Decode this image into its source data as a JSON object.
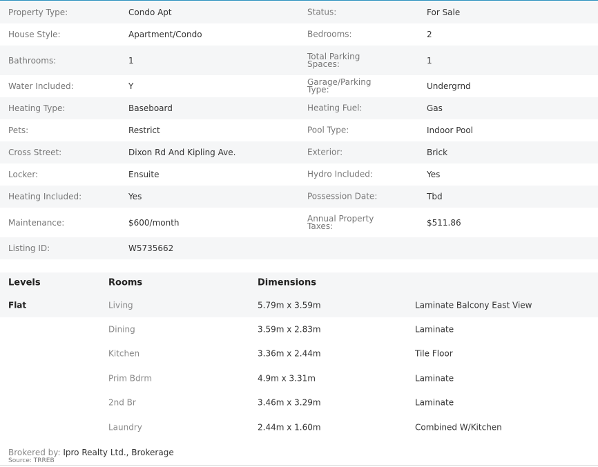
{
  "details": [
    {
      "l1": "Property Type:",
      "v1": "Condo Apt",
      "l2": "Status:",
      "v2": "For Sale"
    },
    {
      "l1": "House Style:",
      "v1": "Apartment/Condo",
      "l2": "Bedrooms:",
      "v2": "2"
    },
    {
      "l1": "Bathrooms:",
      "v1": "1",
      "l2": "Total Parking Spaces:",
      "v2": "1"
    },
    {
      "l1": "Water Included:",
      "v1": "Y",
      "l2": "Garage/Parking Type:",
      "v2": "Undergrnd"
    },
    {
      "l1": "Heating Type:",
      "v1": "Baseboard",
      "l2": "Heating Fuel:",
      "v2": "Gas"
    },
    {
      "l1": "Pets:",
      "v1": "Restrict",
      "l2": "Pool Type:",
      "v2": "Indoor Pool"
    },
    {
      "l1": "Cross Street:",
      "v1": "Dixon Rd And Kipling Ave.",
      "l2": "Exterior:",
      "v2": "Brick"
    },
    {
      "l1": "Locker:",
      "v1": "Ensuite",
      "l2": "Hydro Included:",
      "v2": "Yes"
    },
    {
      "l1": "Heating Included:",
      "v1": "Yes",
      "l2": "Possession Date:",
      "v2": "Tbd"
    },
    {
      "l1": "Maintenance:",
      "v1": "$600/month",
      "l2": "Annual Property Taxes:",
      "v2": "$511.86"
    },
    {
      "l1": "Listing ID:",
      "v1": "W5735662",
      "l2": "",
      "v2": ""
    }
  ],
  "rooms": {
    "headers": {
      "level": "Levels",
      "room": "Rooms",
      "dimensions": "Dimensions"
    },
    "rows": [
      {
        "level": "Flat",
        "room": "Living",
        "dimensions": "5.79m x 3.59m",
        "description": "Laminate Balcony East View"
      },
      {
        "level": "",
        "room": "Dining",
        "dimensions": "3.59m x 2.83m",
        "description": "Laminate"
      },
      {
        "level": "",
        "room": "Kitchen",
        "dimensions": "3.36m x 2.44m",
        "description": "Tile Floor"
      },
      {
        "level": "",
        "room": "Prim Bdrm",
        "dimensions": "4.9m x 3.31m",
        "description": "Laminate"
      },
      {
        "level": "",
        "room": "2nd Br",
        "dimensions": "3.46m x 3.29m",
        "description": "Laminate"
      },
      {
        "level": "",
        "room": "Laundry",
        "dimensions": "2.44m x 1.60m",
        "description": "Combined W/Kitchen"
      }
    ]
  },
  "footer": {
    "brokered_by_label": "Brokered by:",
    "brokerage": "Ipro Realty Ltd., Brokerage",
    "source": "Source: TRREB"
  },
  "colors": {
    "accent_border": "#2a8fbd",
    "row_shade": "#f5f6f7"
  }
}
